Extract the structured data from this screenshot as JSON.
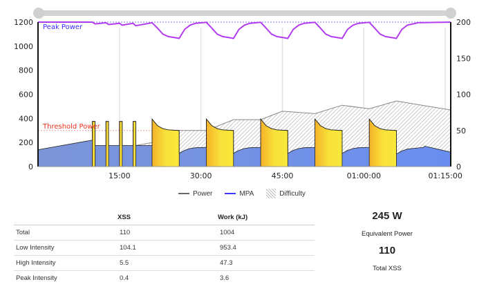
{
  "chart_data": {
    "type": "area",
    "x_unit": "minutes",
    "xlim": [
      0,
      76
    ],
    "y_left": {
      "lim": [
        0,
        1200
      ],
      "ticks": [
        0,
        200,
        400,
        600,
        800,
        1000,
        1200
      ]
    },
    "y_right": {
      "lim": [
        0,
        200
      ],
      "ticks": [
        0,
        50,
        100,
        150,
        200
      ]
    },
    "x_ticks": [
      {
        "value": 15,
        "label": "15:00"
      },
      {
        "value": 30,
        "label": "30:00"
      },
      {
        "value": 45,
        "label": "45:00"
      },
      {
        "value": 60,
        "label": "01:00:00"
      },
      {
        "value": 75,
        "label": "01:15:00"
      }
    ],
    "grid": "vertical",
    "peak_power": {
      "label": "Peak Power",
      "value": 1200,
      "color": "#3a2bff"
    },
    "threshold_power": {
      "label": "Threshold Power",
      "value": 300,
      "color": "#e8301c"
    },
    "power": [
      [
        0,
        140
      ],
      [
        10,
        220
      ],
      [
        10,
        375
      ],
      [
        10.5,
        375
      ],
      [
        10.5,
        175
      ],
      [
        12.5,
        175
      ],
      [
        12.5,
        375
      ],
      [
        13,
        375
      ],
      [
        13,
        175
      ],
      [
        15,
        175
      ],
      [
        15,
        375
      ],
      [
        15.5,
        375
      ],
      [
        15.5,
        175
      ],
      [
        17.5,
        175
      ],
      [
        17.5,
        375
      ],
      [
        18,
        375
      ],
      [
        18,
        175
      ],
      [
        21,
        175
      ],
      [
        21,
        395
      ],
      [
        22,
        340
      ],
      [
        23,
        315
      ],
      [
        24,
        305
      ],
      [
        26,
        300
      ],
      [
        26,
        110
      ],
      [
        27,
        135
      ],
      [
        28,
        150
      ],
      [
        29,
        157
      ],
      [
        31,
        160
      ],
      [
        31,
        395
      ],
      [
        32,
        340
      ],
      [
        33,
        315
      ],
      [
        34,
        305
      ],
      [
        36,
        300
      ],
      [
        36,
        110
      ],
      [
        37,
        135
      ],
      [
        38,
        150
      ],
      [
        39,
        157
      ],
      [
        41,
        160
      ],
      [
        41,
        395
      ],
      [
        42,
        340
      ],
      [
        43,
        315
      ],
      [
        44,
        305
      ],
      [
        46,
        300
      ],
      [
        46,
        110
      ],
      [
        47,
        135
      ],
      [
        48,
        150
      ],
      [
        49,
        157
      ],
      [
        51,
        160
      ],
      [
        51,
        395
      ],
      [
        52,
        340
      ],
      [
        53,
        315
      ],
      [
        54,
        305
      ],
      [
        56,
        300
      ],
      [
        56,
        110
      ],
      [
        57,
        135
      ],
      [
        58,
        150
      ],
      [
        59,
        157
      ],
      [
        61,
        160
      ],
      [
        61,
        395
      ],
      [
        62,
        340
      ],
      [
        63,
        315
      ],
      [
        64,
        305
      ],
      [
        66,
        300
      ],
      [
        66,
        105
      ],
      [
        67,
        130
      ],
      [
        68,
        145
      ],
      [
        70,
        155
      ],
      [
        71,
        160
      ],
      [
        71.2,
        170
      ],
      [
        76,
        120
      ]
    ],
    "high_intensity_intervals": [
      [
        10,
        10.5
      ],
      [
        12.5,
        13
      ],
      [
        15,
        15.5
      ],
      [
        17.5,
        18
      ],
      [
        21,
        26
      ],
      [
        31,
        36
      ],
      [
        41,
        46
      ],
      [
        51,
        56
      ],
      [
        61,
        66
      ]
    ],
    "difficulty": [
      [
        18,
        175
      ],
      [
        21,
        200
      ],
      [
        26,
        300
      ],
      [
        31,
        300
      ],
      [
        36,
        390
      ],
      [
        41,
        390
      ],
      [
        45,
        460
      ],
      [
        51,
        440
      ],
      [
        56,
        510
      ],
      [
        61,
        480
      ],
      [
        66,
        545
      ],
      [
        76,
        470
      ]
    ],
    "mpa": [
      [
        0,
        1200
      ],
      [
        10,
        1200
      ],
      [
        10.5,
        1185
      ],
      [
        12.5,
        1195
      ],
      [
        13,
        1180
      ],
      [
        15,
        1190
      ],
      [
        15.5,
        1175
      ],
      [
        17.5,
        1190
      ],
      [
        18,
        1170
      ],
      [
        21,
        1195
      ],
      [
        22,
        1150
      ],
      [
        23,
        1100
      ],
      [
        24,
        1080
      ],
      [
        26,
        1065
      ],
      [
        27,
        1140
      ],
      [
        28,
        1175
      ],
      [
        29,
        1190
      ],
      [
        31,
        1198
      ],
      [
        32,
        1150
      ],
      [
        33,
        1100
      ],
      [
        34,
        1080
      ],
      [
        36,
        1065
      ],
      [
        37,
        1140
      ],
      [
        38,
        1175
      ],
      [
        39,
        1190
      ],
      [
        41,
        1198
      ],
      [
        42,
        1150
      ],
      [
        43,
        1100
      ],
      [
        44,
        1080
      ],
      [
        46,
        1065
      ],
      [
        47,
        1140
      ],
      [
        48,
        1175
      ],
      [
        49,
        1190
      ],
      [
        51,
        1198
      ],
      [
        52,
        1150
      ],
      [
        53,
        1100
      ],
      [
        54,
        1080
      ],
      [
        56,
        1065
      ],
      [
        57,
        1140
      ],
      [
        58,
        1175
      ],
      [
        59,
        1190
      ],
      [
        61,
        1198
      ],
      [
        62,
        1150
      ],
      [
        63,
        1100
      ],
      [
        64,
        1080
      ],
      [
        66,
        1065
      ],
      [
        67,
        1140
      ],
      [
        68,
        1175
      ],
      [
        70,
        1195
      ],
      [
        76,
        1200
      ]
    ],
    "colors": {
      "power_fill": "#6f8de6",
      "interval_fill": "#f9e43a",
      "interval_edge": "#f4b72a",
      "mpa": "#b23cf0",
      "difficulty": "#888888"
    },
    "legend": {
      "position": "bottom",
      "items": [
        {
          "label": "Power",
          "color": "#666666"
        },
        {
          "label": "MPA",
          "color": "#3a3aff"
        },
        {
          "label": "Difficulty",
          "pattern": "hatch"
        }
      ]
    }
  },
  "table": {
    "headers": [
      "",
      "XSS",
      "Work (kJ)"
    ],
    "rows": [
      [
        "Total",
        "110",
        "1004"
      ],
      [
        "Low Intensity",
        "104.1",
        "953.4"
      ],
      [
        "High Intensity",
        "5.5",
        "47.3"
      ],
      [
        "Peak Intensity",
        "0.4",
        "3.6"
      ]
    ]
  },
  "stats": {
    "equivalent_power_value": "245 W",
    "equivalent_power_label": "Equivalent Power",
    "total_xss_value": "110",
    "total_xss_label": "Total XSS"
  }
}
